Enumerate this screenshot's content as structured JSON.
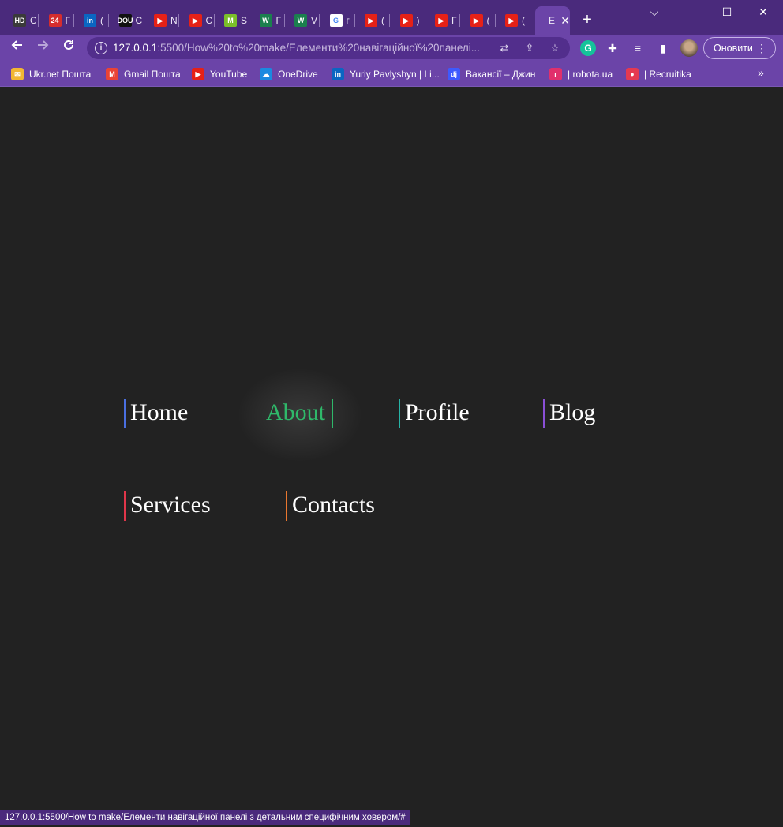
{
  "browser": {
    "tabs": [
      {
        "icon_text": "HD",
        "icon_color": "#3a3a3a",
        "title": "С"
      },
      {
        "icon_text": "24",
        "icon_color": "#d62d2d",
        "title": "Г"
      },
      {
        "icon_text": "in",
        "icon_color": "#0a66c2",
        "title": "("
      },
      {
        "icon_text": "DOU",
        "icon_color": "#111111",
        "title": "С"
      },
      {
        "icon_text": "▶",
        "icon_color": "#e62117",
        "title": "N"
      },
      {
        "icon_text": "▶",
        "icon_color": "#e62117",
        "title": "С"
      },
      {
        "icon_text": "M",
        "icon_color": "#7bbf2a",
        "title": "S"
      },
      {
        "icon_text": "W",
        "icon_color": "#1b7f4e",
        "title": "Г"
      },
      {
        "icon_text": "W",
        "icon_color": "#1b7f4e",
        "title": "V"
      },
      {
        "icon_text": "G",
        "icon_color": "#ffffff",
        "title": "г"
      },
      {
        "icon_text": "▶",
        "icon_color": "#e62117",
        "title": "("
      },
      {
        "icon_text": "▶",
        "icon_color": "#e62117",
        "title": ")"
      },
      {
        "icon_text": "▶",
        "icon_color": "#e62117",
        "title": "Г"
      },
      {
        "icon_text": "▶",
        "icon_color": "#e62117",
        "title": "("
      },
      {
        "icon_text": "▶",
        "icon_color": "#e62117",
        "title": "("
      }
    ],
    "active_tab": {
      "title": "Е"
    },
    "new_tab": "+",
    "window_controls": {
      "tab_search": "⌵",
      "minimize": "—",
      "maximize": "☐",
      "close": "✕"
    },
    "url_host": "127.0.0.1",
    "url_rest": ":5500/How%20to%20make/Елементи%20навігаційної%20панелі...",
    "update_label": "Оновити",
    "bookmarks": [
      {
        "label": "Ukr.net Пошта",
        "icon_color": "#f2b632",
        "icon_text": "✉"
      },
      {
        "label": "Gmail Пошта",
        "icon_color": "#ea4335",
        "icon_text": "M"
      },
      {
        "label": "YouTube",
        "icon_color": "#e62117",
        "icon_text": "▶"
      },
      {
        "label": "OneDrive",
        "icon_color": "#1b8ae0",
        "icon_text": "☁"
      },
      {
        "label": "Yuriy Pavlyshyn | Li...",
        "icon_color": "#0a66c2",
        "icon_text": "in"
      },
      {
        "label": "Вакансії – Джин",
        "icon_color": "#3d5afe",
        "icon_text": "dj"
      },
      {
        "label": "| robota.ua",
        "icon_color": "#e1306c",
        "icon_text": "r"
      },
      {
        "label": "| Recruitika",
        "icon_color": "#e53950",
        "icon_text": "●"
      }
    ],
    "status_url": "127.0.0.1:5500/How to make/Елементи навігаційної панелі з детальним специфічним ховером/#"
  },
  "nav": {
    "items": [
      {
        "label": "Home",
        "accent": "#4a6fe0"
      },
      {
        "label": "About",
        "accent": "#2fb86a",
        "hovered": true
      },
      {
        "label": "Profile",
        "accent": "#27b3a6"
      },
      {
        "label": "Blog",
        "accent": "#8a4fd6"
      },
      {
        "label": "Services",
        "accent": "#e0364a"
      },
      {
        "label": "Contacts",
        "accent": "#e9772f"
      }
    ]
  }
}
